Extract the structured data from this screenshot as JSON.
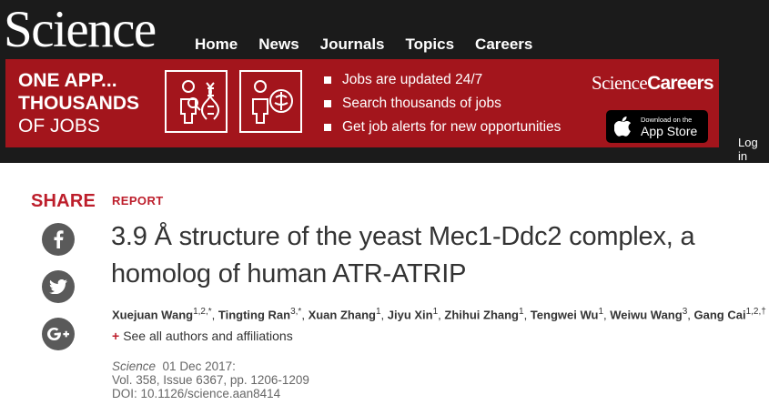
{
  "header": {
    "logo": "Science",
    "nav": [
      "Home",
      "News",
      "Journals",
      "Topics",
      "Careers"
    ],
    "login": "Log in"
  },
  "banner": {
    "left_lines": [
      "ONE APP...",
      "THOUSANDS",
      "OF JOBS"
    ],
    "bullets": [
      "Jobs are updated 24/7",
      "Search thousands of jobs",
      "Get job alerts for new opportunities"
    ],
    "brand_serif": "Science",
    "brand_bold": "Careers",
    "appstore_small": "Download on the",
    "appstore_big": "App Store",
    "color": "#a3151c"
  },
  "share": {
    "label": "SHARE",
    "buttons": [
      {
        "icon": "facebook-icon",
        "glyph": "f"
      },
      {
        "icon": "twitter-icon",
        "glyph": ""
      },
      {
        "icon": "google-plus-icon",
        "glyph": "G+"
      }
    ],
    "icon_bg": "#5a5a5a"
  },
  "article": {
    "type": "REPORT",
    "title": "3.9 Å structure of the yeast Mec1-Ddc2 complex, a homolog of human ATR-ATRIP",
    "authors": [
      {
        "name": "Xuejuan Wang",
        "sup": "1,2,*"
      },
      {
        "name": "Tingting Ran",
        "sup": "3,*"
      },
      {
        "name": "Xuan Zhang",
        "sup": "1"
      },
      {
        "name": "Jiyu Xin",
        "sup": "1"
      },
      {
        "name": "Zhihui Zhang",
        "sup": "1"
      },
      {
        "name": "Tengwei Wu",
        "sup": "1"
      },
      {
        "name": "Weiwu Wang",
        "sup": "3"
      },
      {
        "name": "Gang Cai",
        "sup": "1,2,†"
      }
    ],
    "affiliations_link": "See all authors and affiliations",
    "journal": "Science",
    "date": "01 Dec 2017:",
    "volume": "Vol. 358, Issue 6367, pp. 1206-1209",
    "doi": "DOI: 10.1126/science.aan8414",
    "accent": "#bd1e2b"
  }
}
